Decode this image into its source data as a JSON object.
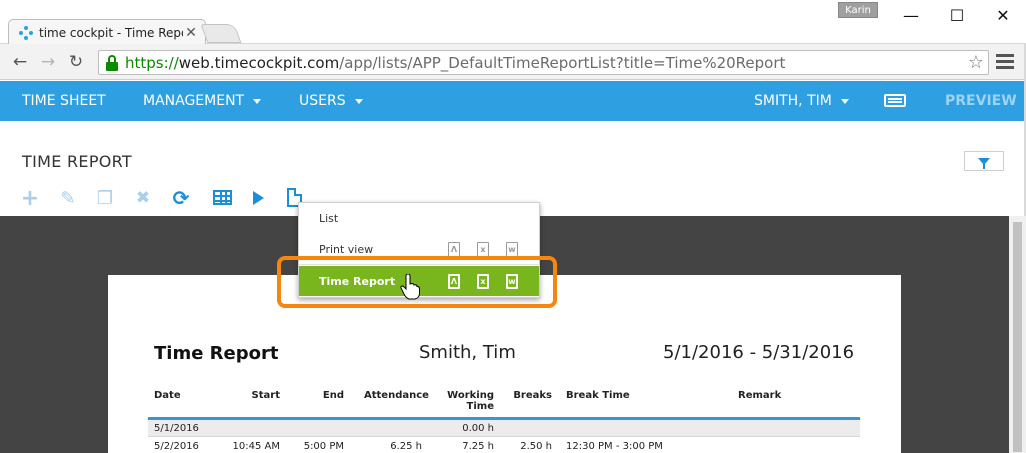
{
  "browser": {
    "tab_title": "time cockpit - Time Repor",
    "user_badge": "Karin",
    "url_scheme": "https://",
    "url_host": "web.timecockpit.com",
    "url_path": "/app/lists/APP_DefaultTimeReportList?title=Time%20Report"
  },
  "nav": {
    "items": [
      {
        "label": "TIME SHEET"
      },
      {
        "label": "MANAGEMENT"
      },
      {
        "label": "USERS"
      }
    ],
    "user": "SMITH, TIM",
    "preview": "PREVIEW"
  },
  "page": {
    "title": "TIME REPORT"
  },
  "dropdown": {
    "items": [
      {
        "label": "List"
      },
      {
        "label": "Print view",
        "formats": [
          "PDF",
          "XLS",
          "DOC"
        ]
      },
      {
        "label": "Time Report",
        "formats": [
          "PDF",
          "XLS",
          "DOC"
        ],
        "selected": true
      }
    ]
  },
  "report": {
    "title": "Time Report",
    "name": "Smith, Tim",
    "range": "5/1/2016 - 5/31/2016",
    "columns": {
      "date": "Date",
      "start": "Start",
      "end": "End",
      "attendance": "Attendance",
      "working_time_1": "Working",
      "working_time_2": "Time",
      "breaks": "Breaks",
      "break_time": "Break Time",
      "remark": "Remark"
    },
    "rows": [
      {
        "date": "5/1/2016",
        "start": "",
        "end": "",
        "attendance": "",
        "working_time": "0.00 h",
        "breaks": "",
        "break_time": ""
      },
      {
        "date": "5/2/2016",
        "start": "10:45 AM",
        "end": "5:00 PM",
        "attendance": "6.25 h",
        "working_time": "7.25 h",
        "breaks": "2.50 h",
        "break_time": "12:30 PM - 3:00 PM"
      }
    ]
  },
  "colors": {
    "nav": "#2e9fe0",
    "accent_green": "#79b51c",
    "highlight_orange": "#f5870f",
    "icon_blue": "#1b8fd6"
  }
}
